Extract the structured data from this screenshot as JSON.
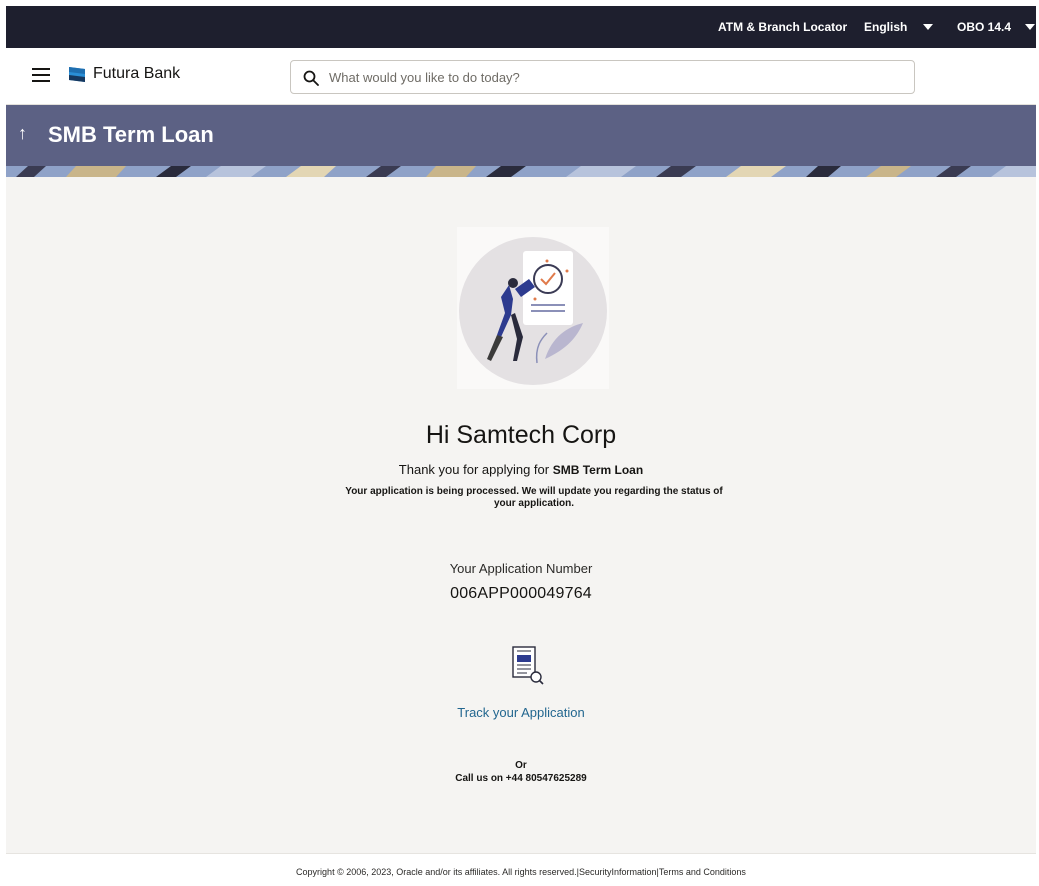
{
  "topbar": {
    "locator": "ATM & Branch Locator",
    "language": "English",
    "obo": "OBO 14.4"
  },
  "header": {
    "brand": "Futura Bank",
    "search_placeholder": "What would you like to do today?"
  },
  "page": {
    "title": "SMB Term Loan"
  },
  "confirmation": {
    "greeting": "Hi Samtech Corp",
    "thanks_prefix": "Thank you for applying for",
    "product": "SMB Term Loan",
    "processing_msg": "Your application is being processed. We will update you regarding the status of your application.",
    "appnum_label": "Your Application Number",
    "appnum": "006APP000049764",
    "track_label": "Track your Application",
    "or": "Or",
    "call": "Call us on +44 80547625289"
  },
  "footer": {
    "copyright": "Copyright © 2006, 2023, Oracle and/or its affiliates. All rights reserved.",
    "security": "SecurityInformation",
    "terms": "Terms and Conditions"
  },
  "colors": {
    "topbar": "#1e1f2e",
    "band": "#5c6184",
    "link": "#22668f",
    "background": "#f5f4f2"
  }
}
